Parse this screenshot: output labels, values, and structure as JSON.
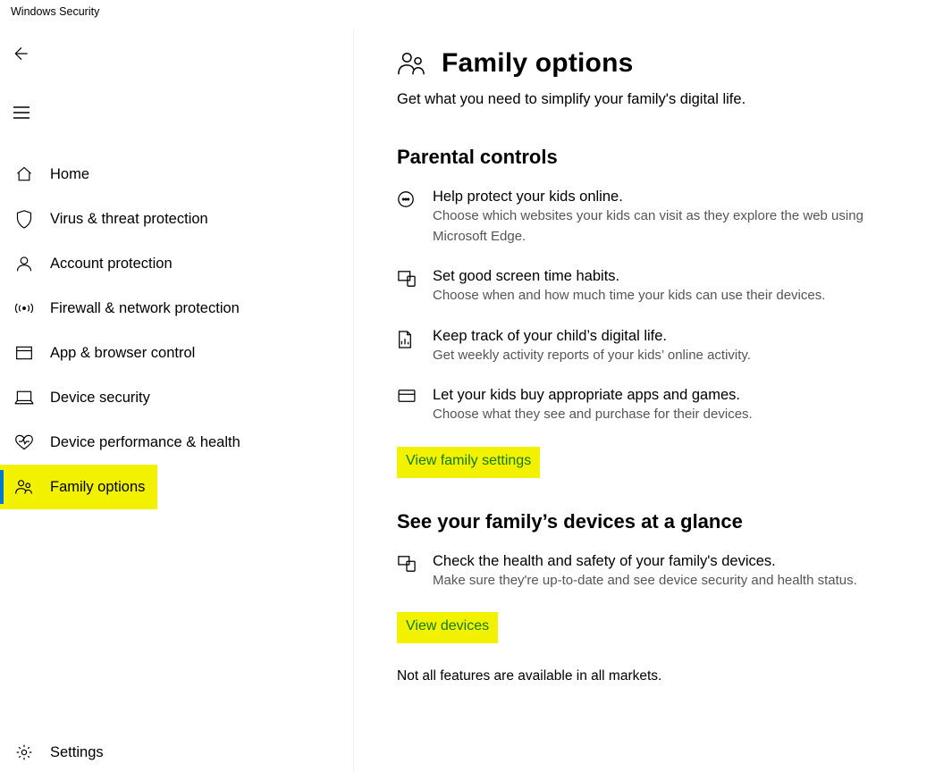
{
  "window": {
    "title": "Windows Security"
  },
  "sidebar": {
    "items": [
      {
        "label": "Home"
      },
      {
        "label": "Virus & threat protection"
      },
      {
        "label": "Account protection"
      },
      {
        "label": "Firewall & network protection"
      },
      {
        "label": "App & browser control"
      },
      {
        "label": "Device security"
      },
      {
        "label": "Device performance & health"
      },
      {
        "label": "Family options"
      }
    ],
    "settings_label": "Settings"
  },
  "page": {
    "title": "Family options",
    "subtitle": "Get what you need to simplify your family's digital life."
  },
  "sections": {
    "parental": {
      "title": "Parental controls",
      "items": [
        {
          "title": "Help protect your kids online.",
          "desc": "Choose which websites your kids can visit as they explore the web using Microsoft Edge."
        },
        {
          "title": "Set good screen time habits.",
          "desc": "Choose when and how much time your kids can use their devices."
        },
        {
          "title": "Keep track of your child’s digital life.",
          "desc": "Get weekly activity reports of your kids’ online activity."
        },
        {
          "title": "Let your kids buy appropriate apps and games.",
          "desc": "Choose what they see and purchase for their devices."
        }
      ],
      "link": "View family settings"
    },
    "devices": {
      "title": "See your family’s devices at a glance",
      "items": [
        {
          "title": "Check the health and safety of your family's devices.",
          "desc": "Make sure they're up-to-date and see device security and health status."
        }
      ],
      "link": "View devices"
    }
  },
  "footer_note": "Not all features are available in all markets."
}
